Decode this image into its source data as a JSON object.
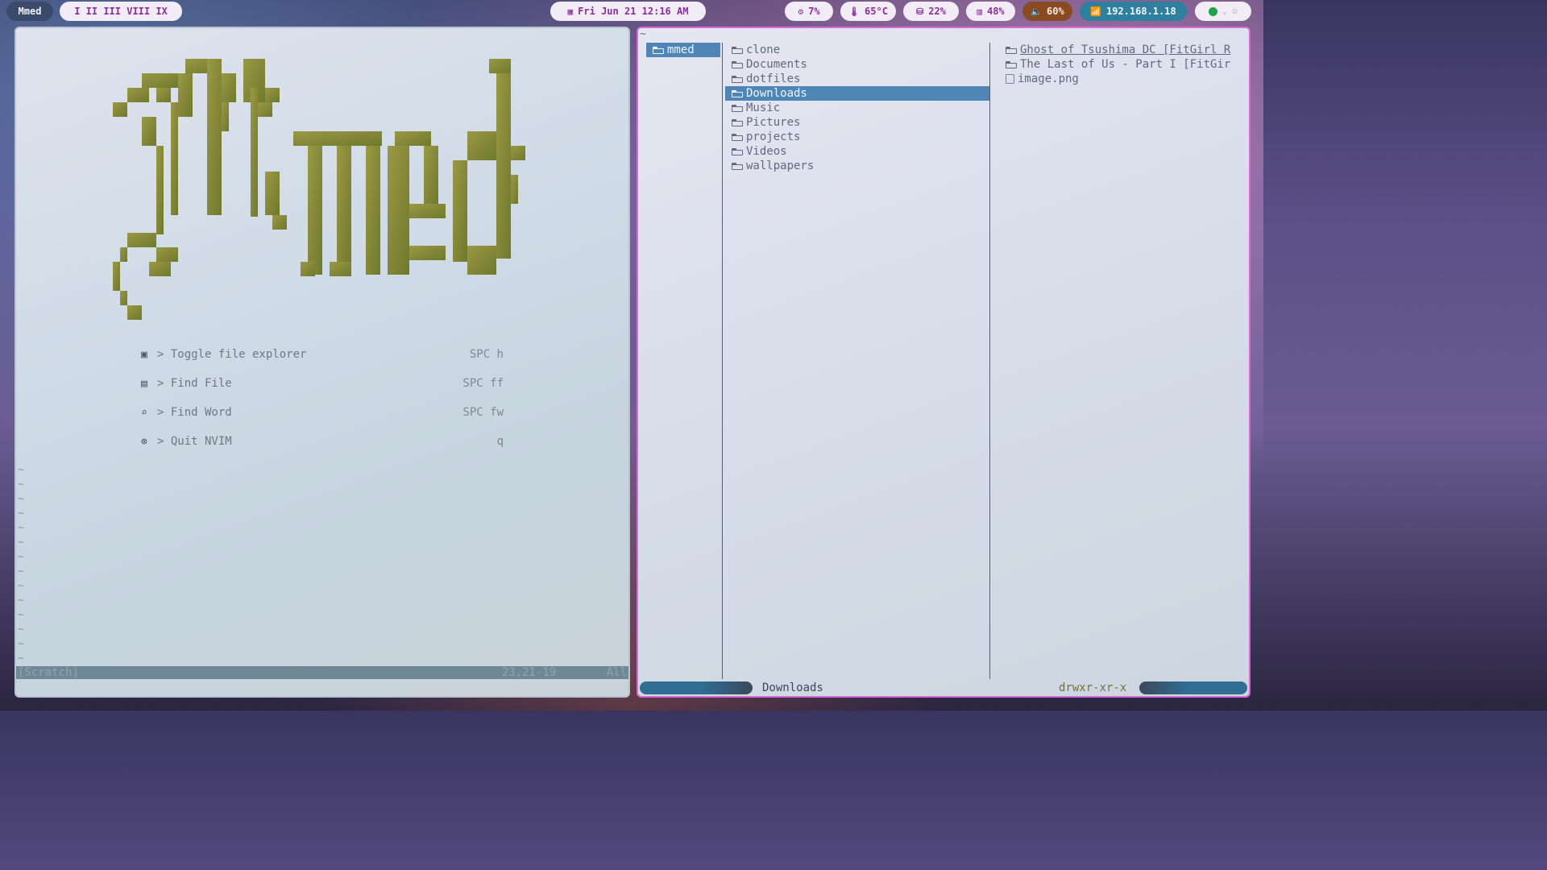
{
  "topbar": {
    "user": "Mmed",
    "workspaces": "I  II  III  VIII  IX",
    "clock": "Fri Jun 21  12:16 AM",
    "cpu": "7%",
    "temp": "65°C",
    "disk": "22%",
    "mem": "48%",
    "volume": "60%",
    "ip": "192.168.1.18"
  },
  "colors": {
    "pill_text": "#8a2f9b",
    "volume_bg": "#8a4a22",
    "ip_bg": "#2f7f9f",
    "logo": "#8a8c3c",
    "selection": "#4f86b6"
  },
  "nvim": {
    "logo_text": "Mmed",
    "menu": [
      {
        "icon": "folder-icon",
        "label": "> Toggle file explorer",
        "shortcut": "SPC h"
      },
      {
        "icon": "file-search-icon",
        "label": "> Find File",
        "shortcut": "SPC ff"
      },
      {
        "icon": "search-icon",
        "label": "> Find Word",
        "shortcut": "SPC fw"
      },
      {
        "icon": "close-circle-icon",
        "label": "> Quit NVIM",
        "shortcut": "q"
      }
    ],
    "status": {
      "buffer": "[Scratch]",
      "position": "23,21-19",
      "scroll": "All"
    }
  },
  "ranger": {
    "header": "~",
    "parent": [
      "mmed"
    ],
    "current": [
      "clone",
      "Documents",
      "dotfiles",
      "Downloads",
      "Music",
      "Pictures",
      "projects",
      "Videos",
      "wallpapers"
    ],
    "preview": [
      {
        "name": "Ghost of Tsushima DC [FitGirl R",
        "type": "folder"
      },
      {
        "name": "The Last of Us - Part I [FitGir",
        "type": "folder"
      },
      {
        "name": "image.png",
        "type": "image"
      }
    ],
    "status": {
      "path": "Downloads",
      "perms": "drwxr-xr-x"
    }
  }
}
